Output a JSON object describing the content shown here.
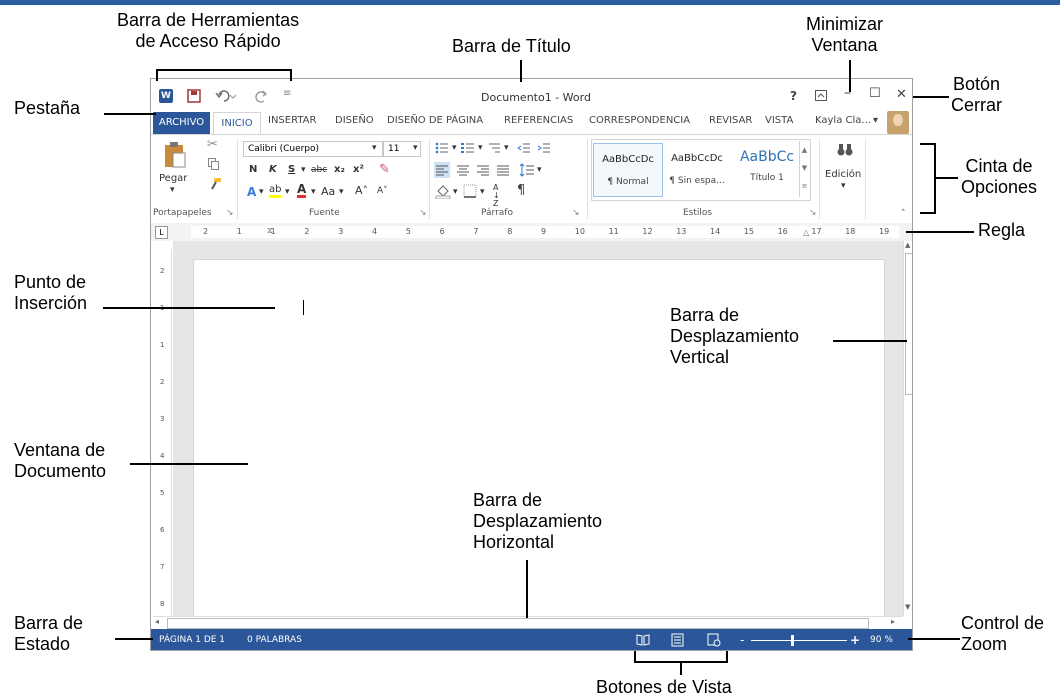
{
  "callouts": {
    "qat": "Barra de Herramientas\nde Acceso Rápido",
    "title_bar": "Barra de Título",
    "minimize": "Minimizar\nVentana",
    "close": "Botón\nCerrar",
    "tab": "Pestaña",
    "ribbon": "Cinta de\nOpciones",
    "ruler": "Regla",
    "insertion": "Punto de\nInserción",
    "vscroll": "Barra de\nDesplazamiento\nVertical",
    "docwindow": "Ventana de\nDocumento",
    "hscroll": "Barra de\nDesplazamiento\nHorizontal",
    "status": "Barra de\nEstado",
    "zoom": "Control de\nZoom",
    "views": "Botones de Vista"
  },
  "window": {
    "title": "Documento1 - Word",
    "help": "?",
    "minimize_glyph": "–",
    "maximize_glyph": "☐",
    "close_glyph": "✕",
    "user": "Kayla Cla...",
    "user_arrow": "▾"
  },
  "tabs": [
    "ARCHIVO",
    "INICIO",
    "INSERTAR",
    "DISEÑO",
    "DISEÑO DE PÁGINA",
    "REFERENCIAS",
    "CORRESPONDENCIA",
    "REVISAR",
    "VISTA"
  ],
  "ribbon": {
    "paste": "Pegar",
    "paste_arrow": "▾",
    "clipboard_label": "Portapapeles",
    "font_name": "Calibri (Cuerpo)",
    "font_size": "11",
    "font_label": "Fuente",
    "bold": "N",
    "italic": "K",
    "underline": "S",
    "strike": "abc",
    "sub": "x₂",
    "sup": "x²",
    "case": "Aa",
    "grow": "A˄",
    "shrink": "A˅",
    "paragraph_label": "Párrafo",
    "pilcrow": "¶",
    "sort": "A↓Z",
    "styles": [
      {
        "preview": "AaBbCcDc",
        "name": "¶ Normal"
      },
      {
        "preview": "AaBbCcDc",
        "name": "¶ Sin espa..."
      },
      {
        "preview": "AaBbCc",
        "name": "Título 1"
      }
    ],
    "styles_label": "Estilos",
    "editing": "Edición",
    "editing_arrow": "▾"
  },
  "ruler_numbers": [
    "2",
    "1",
    "1",
    "2",
    "3",
    "4",
    "5",
    "6",
    "7",
    "8",
    "9",
    "10",
    "11",
    "12",
    "13",
    "14",
    "15",
    "16",
    "17",
    "18",
    "19"
  ],
  "vruler_numbers": [
    "2",
    "1",
    "1",
    "2",
    "3",
    "4",
    "5",
    "6",
    "7",
    "8"
  ],
  "status": {
    "page": "PÁGINA 1 DE 1",
    "words": "0 PALABRAS",
    "zoom_minus": "-",
    "zoom_plus": "+",
    "zoom_value": "90 %"
  },
  "colors": {
    "accent": "#2b579a",
    "top_strip": "#2a5d9f"
  }
}
